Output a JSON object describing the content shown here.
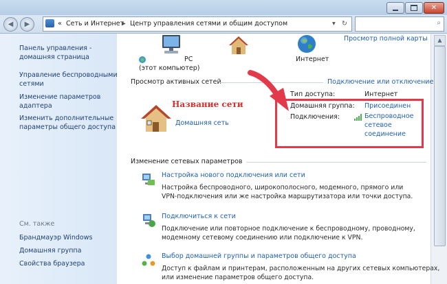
{
  "window": {
    "controls": [
      "minimize-icon",
      "maximize-icon",
      "close-icon"
    ]
  },
  "address": {
    "crumb_1": "Сеть и Интернет",
    "crumb_2": "Центр управления сетями и общим доступом",
    "separator": "▸",
    "overflow": "«"
  },
  "sidebar": {
    "items": [
      {
        "label": "Панель управления - домашняя страница"
      },
      {
        "label": "Управление беспроводными сетями"
      },
      {
        "label": "Изменение параметров адаптера"
      },
      {
        "label": "Изменить дополнительные параметры общего доступа"
      }
    ],
    "see_also_label": "См. также",
    "see_also": [
      {
        "label": "Брандмауэр Windows"
      },
      {
        "label": "Домашняя группа"
      },
      {
        "label": "Свойства браузера"
      }
    ]
  },
  "map": {
    "full_map_link": "Просмотр полной карты",
    "pc_label": "PC",
    "pc_sublabel": "(этот компьютер)",
    "internet_label": "Интернет"
  },
  "active": {
    "header": "Просмотр активных сетей",
    "connect_link": "Подключение или отключение",
    "network_name_annotation": "Название сети",
    "network_type": "Домашняя сеть",
    "access_type_label": "Тип доступа:",
    "access_type_value": "Интернет",
    "homegroup_label": "Домашняя группа:",
    "homegroup_value": "Присоединен",
    "connections_label": "Подключения:",
    "connection_value": "Беспроводное сетевое соединение"
  },
  "change": {
    "header": "Изменение сетевых параметров",
    "tasks": [
      {
        "title": "Настройка нового подключения или сети",
        "desc_1": "Настройка беспроводного, широкополосного, модемного, прямого или",
        "desc_2": "VPN-подключения или же настройка маршрутизатора или точки доступа."
      },
      {
        "title": "Подключиться к сети",
        "desc_1": "Подключение или повторное подключение к беспроводному, проводному,",
        "desc_2": "модемному сетевому соединению или подключение к VPN."
      },
      {
        "title": "Выбор домашней группы и параметров общего доступа",
        "desc_1": "Доступ к файлам и принтерам, расположенным на других сетевых компьютерах,",
        "desc_2": "или изменение параметров общего доступа."
      }
    ]
  },
  "colors": {
    "link": "#1f5fb0",
    "annotation_red": "#e23a4a",
    "sidebar_bg": "#dde9f7"
  }
}
